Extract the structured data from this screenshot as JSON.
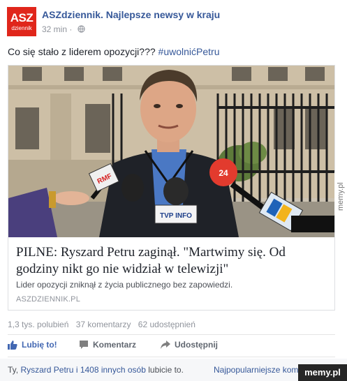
{
  "header": {
    "logo_line1": "ASZ",
    "logo_line2": "dziennik",
    "page_name": "ASZdziennik. Najlepsze newsy w kraju",
    "time_ago": "32 min · "
  },
  "post": {
    "text": "Co się stało z liderem opozycji??? ",
    "hashtag": "#uwolnićPetru"
  },
  "card": {
    "image_mic_labels": [
      "RMF",
      "TVP INFO",
      "24"
    ],
    "title": "PILNE: Ryszard Petru zaginął. \"Martwimy się. Od godziny nikt go nie widział w telewizji\"",
    "description": "Lider opozycji zniknął z życia publicznego bez zapowiedzi.",
    "source": "ASZDZIENNIK.PL"
  },
  "stats": {
    "likes": "1,3 tys. polubień",
    "comments": "37 komentarzy",
    "shares": "62 udostępnień"
  },
  "actions": {
    "like_label": "Lubię to!",
    "comment_label": "Komentarz",
    "share_label": "Udostępnij"
  },
  "footer": {
    "likes_prefix": "Ty, ",
    "likes_link": "Ryszard Petru i 1408 innych osób",
    "likes_suffix": " lubicie to.",
    "sort_label": "Najpopularniejsze komentarze"
  },
  "watermark": {
    "side": "memy.pl",
    "corner": "memy.pl"
  },
  "colors": {
    "brand_red": "#e0261b",
    "fb_link": "#365899",
    "fb_like": "#4267b2"
  }
}
